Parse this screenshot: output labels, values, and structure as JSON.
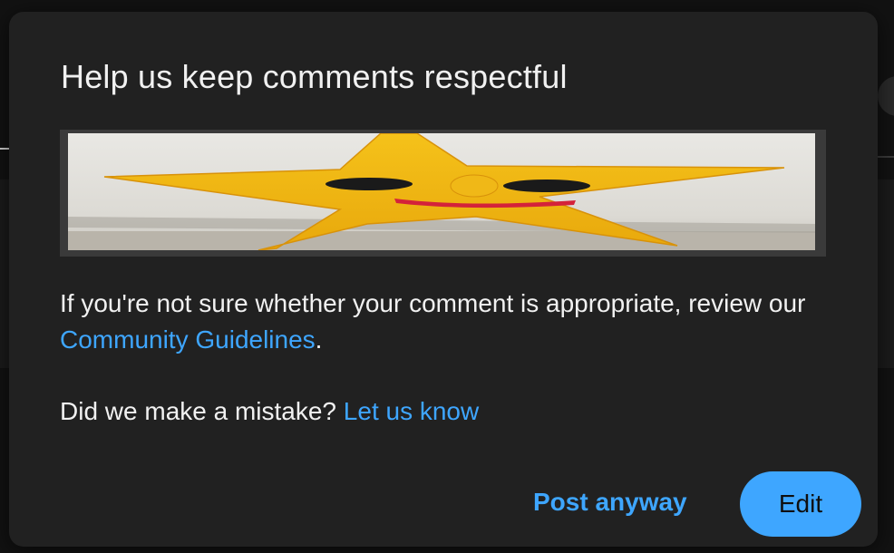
{
  "dialog": {
    "title": "Help us keep comments respectful",
    "image_alt": "Yellow smiling star figure",
    "body_prefix": "If you're not sure whether your comment is appropriate, review our ",
    "guidelines_link": "Community Guidelines",
    "body_suffix": ".",
    "mistake_prefix": "Did we make a mistake? ",
    "mistake_link": "Let us know",
    "post_anyway_label": "Post anyway",
    "edit_label": "Edit"
  },
  "colors": {
    "dialog_bg": "#212121",
    "link": "#3ea6ff",
    "primary_button": "#3ea6ff",
    "text": "#f1f1f1"
  }
}
